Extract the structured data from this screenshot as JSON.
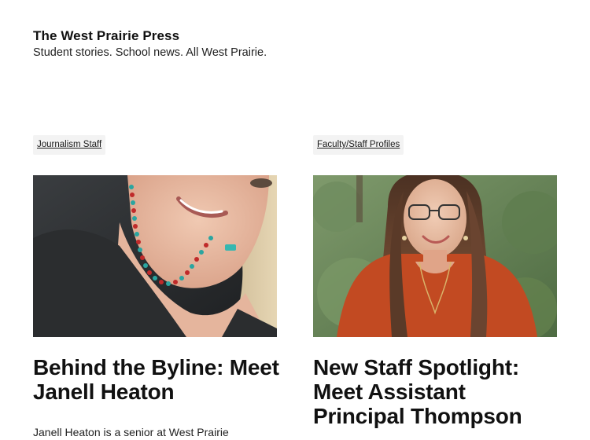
{
  "site": {
    "title": "The West Prairie Press",
    "tagline": "Student stories. School news. All West Prairie."
  },
  "posts": [
    {
      "category": "Journalism Staff",
      "title_line1": "Behind the Byline: Meet",
      "title_line2": "Janell Heaton",
      "excerpt": "Janell Heaton is a senior at West Prairie"
    },
    {
      "category": "Faculty/Staff Profiles",
      "title_line1": "New Staff Spotlight:",
      "title_line2": "Meet Assistant",
      "title_line3": "Principal Thompson",
      "excerpt": ""
    }
  ]
}
